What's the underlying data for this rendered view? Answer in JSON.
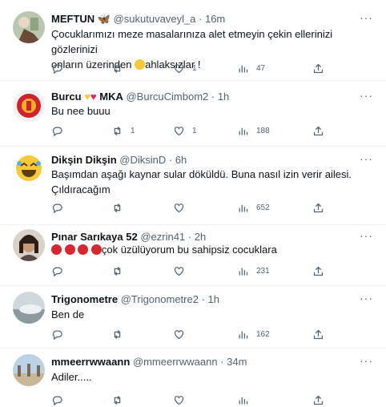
{
  "tweets": [
    {
      "name": "MEFTUN",
      "handle": "@sukutuvaveyl_a · 16m",
      "lines": [
        "Çocuklarımızı meze masalarınıza  alet etmeyin çekin ellerinizi  gözlerinizi",
        "onların üzerinden",
        "ahlaksızlar !"
      ],
      "reply": "",
      "retweet": "",
      "like": "1",
      "views": "47"
    },
    {
      "name": "Burcu",
      "name2": "MKA",
      "handle": "@BurcuCimbom2 · 1h",
      "lines": [
        "Bu nee buuu"
      ],
      "reply": "",
      "retweet": "1",
      "like": "1",
      "views": "188"
    },
    {
      "name": "Dikşin Dikşin",
      "handle": "@DiksinD · 6h",
      "lines": [
        "Başımdan aşağı kaynar sular döküldü. Buna nasıl izin verir ailesi.",
        "Çıldıracağım"
      ],
      "reply": "",
      "retweet": "",
      "like": "",
      "views": "652"
    },
    {
      "name": "Pınar Sarıkaya 52",
      "handle": "@ezrin41 · 2h",
      "lines": [
        "çok üzülüyorum bu sahipsiz cocuklara"
      ],
      "reply": "",
      "retweet": "",
      "like": "",
      "views": "231"
    },
    {
      "name": "Trigonometre",
      "handle": "@Trigonometre2 · 1h",
      "lines": [
        "Ben de"
      ],
      "reply": "",
      "retweet": "",
      "like": "",
      "views": "162"
    },
    {
      "name": "mmeerrwwaann",
      "handle": "@mmeerrwwaann · 34m",
      "lines": [
        "Adiler....."
      ],
      "reply": "",
      "retweet": "",
      "like": "",
      "views": ""
    }
  ],
  "more_label": "···",
  "colors": {
    "text": "#0f1419",
    "secondary": "#536471",
    "divider": "#eff3f4"
  }
}
